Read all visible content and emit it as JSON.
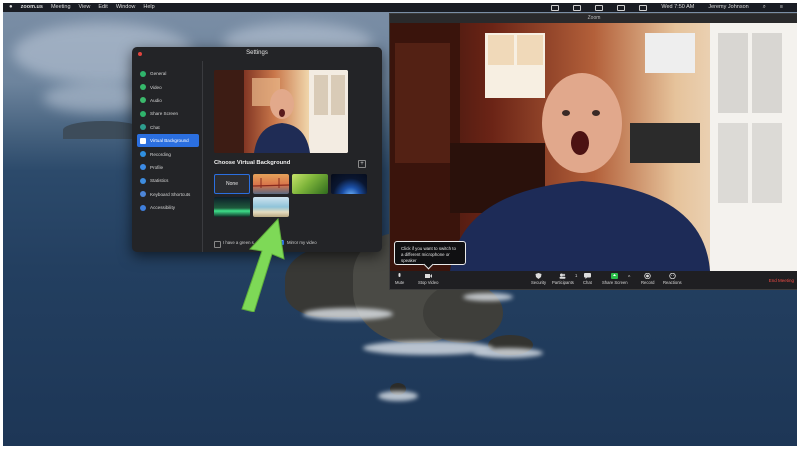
{
  "menubar": {
    "apple": "",
    "app_name": "zoom.us",
    "items": [
      "Meeting",
      "View",
      "Edit",
      "Window",
      "Help"
    ],
    "clock": "Wed 7:50 AM",
    "user": "Jeremy Johnson"
  },
  "settings": {
    "title": "Settings",
    "sidebar": [
      {
        "label": "General",
        "color": "#2fb36b"
      },
      {
        "label": "Video",
        "color": "#35b86a"
      },
      {
        "label": "Audio",
        "color": "#3bb86c"
      },
      {
        "label": "Share Screen",
        "color": "#2fb36b"
      },
      {
        "label": "Chat",
        "color": "#2e9e8e"
      },
      {
        "label": "Virtual Background",
        "color": "#ffffff",
        "active": true
      },
      {
        "label": "Recording",
        "color": "#2f8fe0"
      },
      {
        "label": "Profile",
        "color": "#3c8be6"
      },
      {
        "label": "Statistics",
        "color": "#3e8cde"
      },
      {
        "label": "Keyboard Shortcuts",
        "color": "#4d86d8"
      },
      {
        "label": "Accessibility",
        "color": "#3f7fdc"
      }
    ],
    "choose_title": "Choose Virtual Background",
    "plus": "+",
    "none_label": "None",
    "green_screen_label": "I have a green s",
    "mirror_label": "Mirror my video",
    "mirror_checked": true
  },
  "zoom": {
    "title": "Zoom",
    "tooltip": "Click if you want to switch to a different microphone or speaker",
    "controls": {
      "mute": "Mute",
      "stop_video": "Stop Video",
      "security": "Security",
      "participants": "Participants",
      "participants_count": "1",
      "chat": "Chat",
      "share_screen": "Share Screen",
      "record": "Record",
      "reactions": "Reactions",
      "end_meeting": "End Meeting"
    }
  },
  "colors": {
    "accent": "#2b6fe0",
    "share_green": "#2bbf4a",
    "end_red": "#ef4b44",
    "arrow_green": "#7ed957"
  }
}
